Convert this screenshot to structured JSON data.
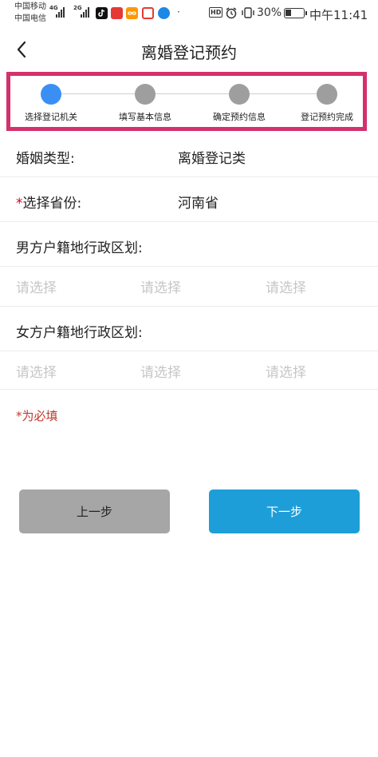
{
  "status_bar": {
    "carrier1": "中国移动",
    "carrier2": "中国电信",
    "net1": "4G",
    "net2": "2G",
    "battery": "30%",
    "time": "中午11:41",
    "hd": "HD"
  },
  "header": {
    "title": "离婚登记预约"
  },
  "steps": [
    {
      "label": "选择登记机关",
      "active": true
    },
    {
      "label": "填写基本信息",
      "active": false
    },
    {
      "label": "确定预约信息",
      "active": false
    },
    {
      "label": "登记预约完成",
      "active": false
    }
  ],
  "form": {
    "marriage_type": {
      "label": "婚姻类型:",
      "value": "离婚登记类"
    },
    "province": {
      "required_mark": "*",
      "label": "选择省份:",
      "value": "河南省"
    },
    "male_region": {
      "label": "男方户籍地行政区划:",
      "placeholders": [
        "请选择",
        "请选择",
        "请选择"
      ]
    },
    "female_region": {
      "label": "女方户籍地行政区划:",
      "placeholders": [
        "请选择",
        "请选择",
        "请选择"
      ]
    },
    "required_note": "*为必填"
  },
  "buttons": {
    "prev": "上一步",
    "next": "下一步"
  },
  "colors": {
    "active_step": "#3a8ff5",
    "inactive_step": "#9e9e9e",
    "highlight_border": "#d4306c",
    "next_button": "#1e9ed9",
    "prev_button": "#a6a6a6",
    "required": "#d0021b"
  }
}
